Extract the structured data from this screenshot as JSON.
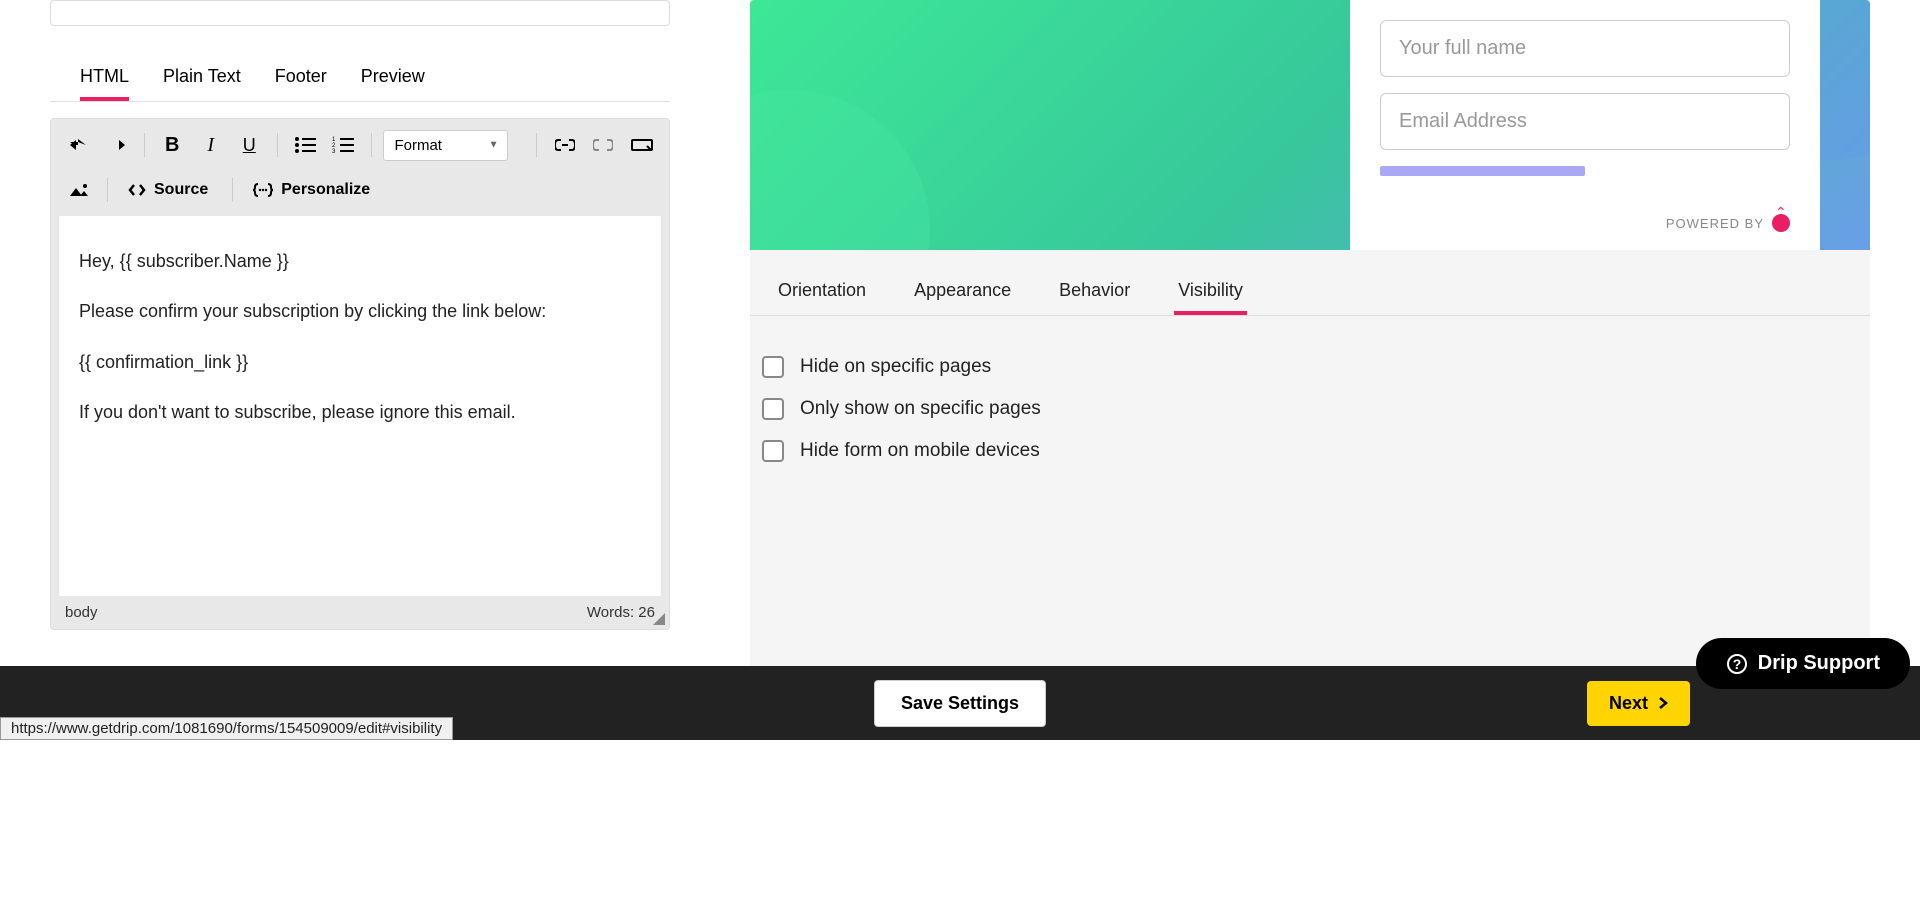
{
  "editor_tabs": [
    "HTML",
    "Plain Text",
    "Footer",
    "Preview"
  ],
  "toolbar": {
    "format_label": "Format",
    "source_label": "Source",
    "personalize_label": "Personalize"
  },
  "content": {
    "line1": "Hey, {{ subscriber.Name }}",
    "line2": "Please confirm your subscription by clicking the link below:",
    "line3": "{{ confirmation_link }}",
    "line4": "If you don't want to subscribe, please ignore this email."
  },
  "editor_footer": {
    "path": "body",
    "words": "Words: 26"
  },
  "form": {
    "name_placeholder": "Your full name",
    "email_placeholder": "Email Address",
    "powered": "POWERED BY"
  },
  "preview_tabs": [
    "Orientation",
    "Appearance",
    "Behavior",
    "Visibility"
  ],
  "visibility": {
    "hide_specific": "Hide on specific pages",
    "only_specific": "Only show on specific pages",
    "hide_mobile": "Hide form on mobile devices"
  },
  "footer": {
    "save": "Save Settings",
    "next": "Next",
    "support": "Drip Support"
  },
  "status_url": "https://www.getdrip.com/1081690/forms/154509009/edit#visibility"
}
